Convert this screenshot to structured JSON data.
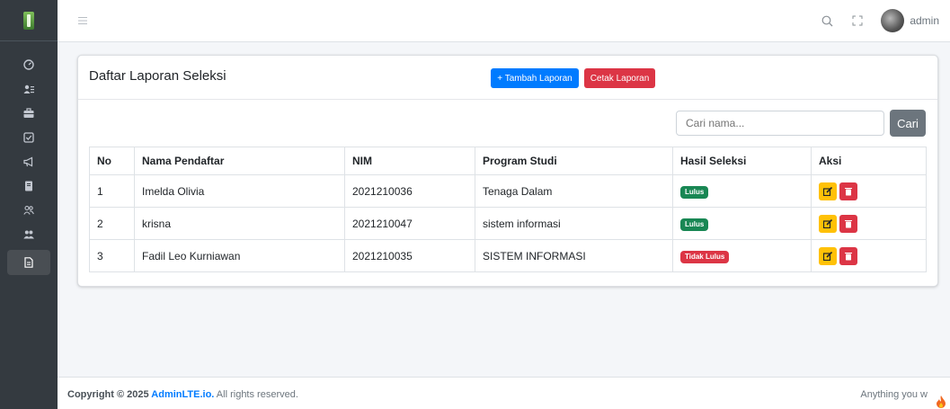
{
  "sidebar": {
    "items": [
      {
        "icon": "dashboard-icon"
      },
      {
        "icon": "users-list-icon"
      },
      {
        "icon": "briefcase-icon"
      },
      {
        "icon": "checkbox-icon"
      },
      {
        "icon": "bullhorn-icon"
      },
      {
        "icon": "book-icon"
      },
      {
        "icon": "user-group-icon"
      },
      {
        "icon": "users-icon"
      },
      {
        "icon": "file-icon",
        "active": true
      }
    ]
  },
  "header": {
    "user_name": "admin"
  },
  "card": {
    "title": "Daftar Laporan Seleksi",
    "add_button": "+ Tambah Laporan",
    "print_button": "Cetak Laporan",
    "search_placeholder": "Cari nama...",
    "search_button": "Cari"
  },
  "table": {
    "headers": [
      "No",
      "Nama Pendaftar",
      "NIM",
      "Program Studi",
      "Hasil Seleksi",
      "Aksi"
    ],
    "rows": [
      {
        "no": "1",
        "nama": "Imelda Olivia",
        "nim": "2021210036",
        "prodi": "Tenaga Dalam",
        "hasil": "Lulus",
        "status": "success"
      },
      {
        "no": "2",
        "nama": "krisna",
        "nim": "2021210047",
        "prodi": "sistem informasi",
        "hasil": "Lulus",
        "status": "success"
      },
      {
        "no": "3",
        "nama": "Fadil Leo Kurniawan",
        "nim": "2021210035",
        "prodi": "SISTEM INFORMASI",
        "hasil": "Tidak Lulus",
        "status": "danger"
      }
    ]
  },
  "footer": {
    "copyright_prefix": "Copyright © 2025 ",
    "brand": "AdminLTE.io.",
    "copyright_suffix": " All rights reserved.",
    "right_text": "Anything you w"
  },
  "colors": {
    "primary": "#007bff",
    "danger": "#dc3545",
    "success": "#198754",
    "warning": "#ffc107",
    "sidebar": "#343a40"
  }
}
